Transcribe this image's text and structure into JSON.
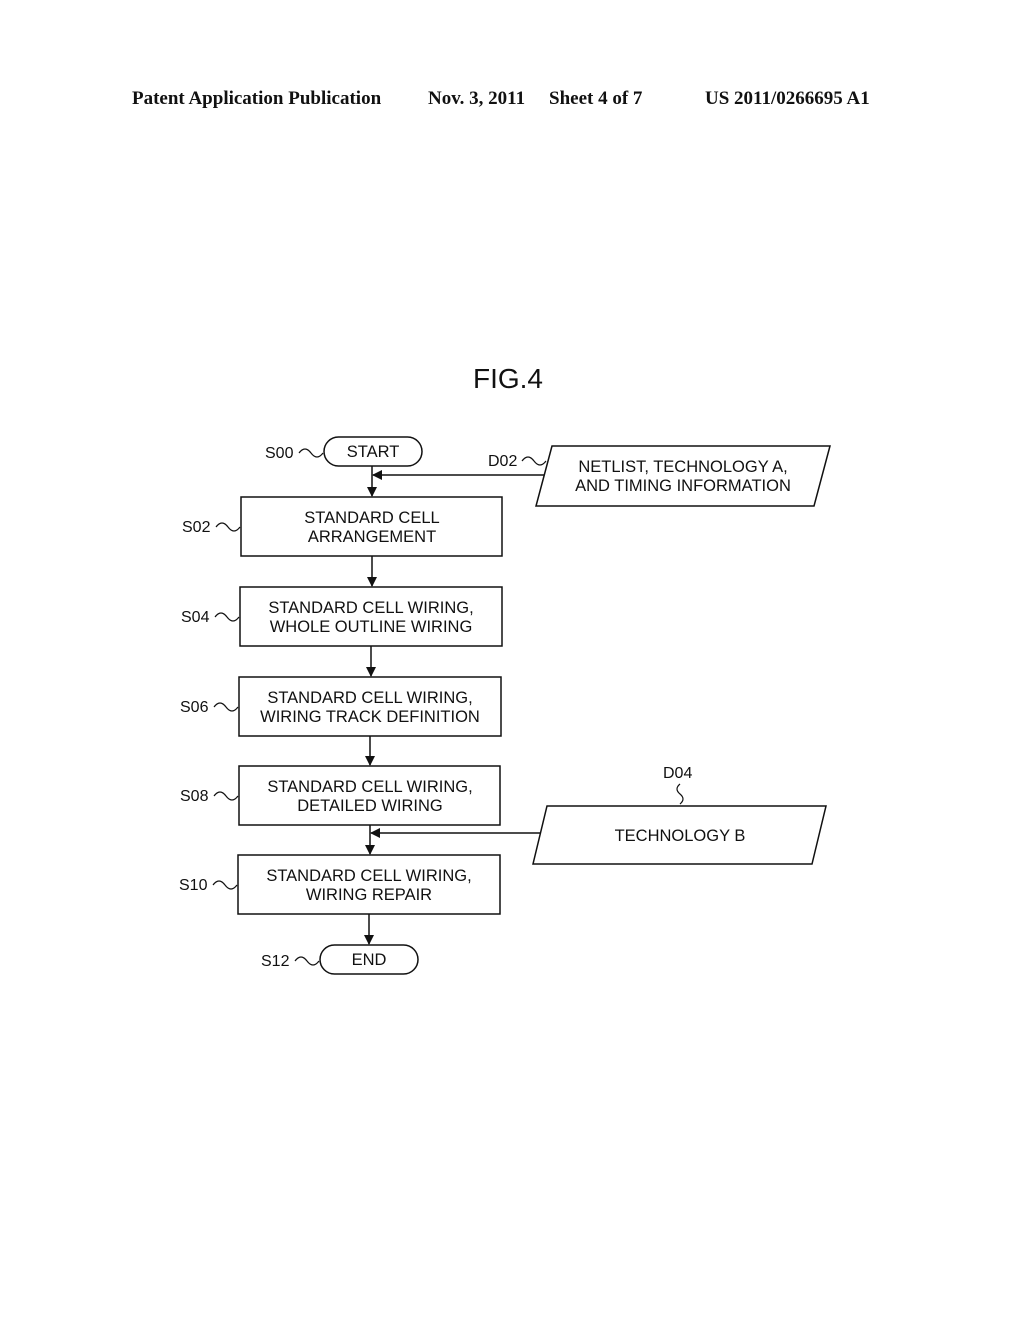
{
  "header": {
    "publication": "Patent Application Publication",
    "date": "Nov. 3, 2011",
    "sheet": "Sheet 4 of 7",
    "number": "US 2011/0266695 A1"
  },
  "figure": {
    "title": "FIG.4"
  },
  "flowchart": {
    "start": {
      "ref": "S00",
      "label": "START"
    },
    "steps": [
      {
        "ref": "S02",
        "lines": [
          "STANDARD CELL",
          "ARRANGEMENT"
        ]
      },
      {
        "ref": "S04",
        "lines": [
          "STANDARD CELL WIRING,",
          "WHOLE OUTLINE WIRING"
        ]
      },
      {
        "ref": "S06",
        "lines": [
          "STANDARD CELL WIRING,",
          "WIRING TRACK DEFINITION"
        ]
      },
      {
        "ref": "S08",
        "lines": [
          "STANDARD CELL WIRING,",
          "DETAILED WIRING"
        ]
      },
      {
        "ref": "S10",
        "lines": [
          "STANDARD CELL WIRING,",
          "WIRING REPAIR"
        ]
      }
    ],
    "end": {
      "ref": "S12",
      "label": "END"
    },
    "data_inputs": [
      {
        "ref": "D02",
        "lines": [
          "NETLIST, TECHNOLOGY A,",
          "AND TIMING INFORMATION"
        ],
        "feeds_before": "S02"
      },
      {
        "ref": "D04",
        "lines": [
          "TECHNOLOGY B"
        ],
        "feeds_before": "S10"
      }
    ]
  }
}
